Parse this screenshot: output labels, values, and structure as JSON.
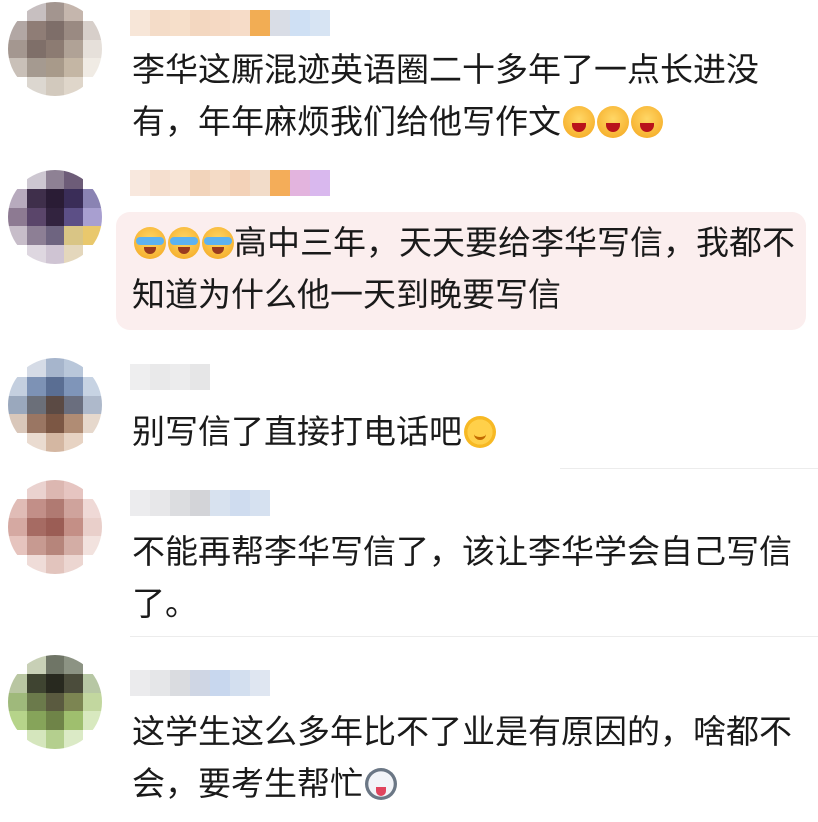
{
  "comments": [
    {
      "text": "李华这厮混迹英语圈二十多年了一点长进没有，年年麻烦我们给他写作文",
      "emojis": [
        "angry-face-icon",
        "angry-face-icon",
        "angry-face-icon"
      ],
      "avatar_colors": [
        "#ffffff",
        "#c7bfc0",
        "#a3958f",
        "#c5b6ad",
        "#ffffff",
        "#b2a7a4",
        "#8f7d76",
        "#7e6e69",
        "#9a8a82",
        "#d7cfca",
        "#a49790",
        "#7f6f69",
        "#8c7b72",
        "#b0a296",
        "#e6e0da",
        "#c9c0b8",
        "#a59a90",
        "#a89a8a",
        "#c4b6a4",
        "#f0ebe4",
        "#ffffff",
        "#dcd7d0",
        "#d2c9bd",
        "#dfd6ca",
        "#ffffff"
      ],
      "name_colors": [
        "#f7e6d8",
        "#f4dcc8",
        "#f6dfca",
        "#f3d7c0",
        "#f5d9c3",
        "#f6dcc8",
        "#f2ad54",
        "#d9dde6",
        "#cfe0f4",
        "#d7e4f3"
      ]
    },
    {
      "text": "高中三年，天天要给李华写信，我都不知道为什么他一天到晚要写信",
      "emojis": [
        "crying-laughing-icon",
        "crying-laughing-icon",
        "crying-laughing-icon"
      ],
      "avatar_colors": [
        "#ffffff",
        "#cdc7d1",
        "#8e8194",
        "#6d5c78",
        "#ffffff",
        "#b7aabd",
        "#3f2f4b",
        "#2a1c35",
        "#3a2d58",
        "#8a83b3",
        "#8d7a92",
        "#5a456a",
        "#32233f",
        "#5c4f86",
        "#a89fd0",
        "#c7bdc9",
        "#8d7f95",
        "#6e6480",
        "#d9c585",
        "#e9c86c",
        "#ffffff",
        "#ded7e0",
        "#cfc4d3",
        "#e4d7bc",
        "#ffffff"
      ],
      "name_colors": [
        "#f8e8de",
        "#f5dfcf",
        "#f7e4d6",
        "#f2d4bb",
        "#f4dbc6",
        "#f3d2b8",
        "#f2dcc9",
        "#f4ad59",
        "#e3b4de",
        "#d9b8ee"
      ]
    },
    {
      "text": "别写信了直接打电话吧",
      "emojis": [
        "sunflower-face-icon"
      ],
      "avatar_colors": [
        "#ffffff",
        "#d5dbe6",
        "#a6b5cc",
        "#b9c7da",
        "#ffffff",
        "#c4cfdf",
        "#7d92b5",
        "#5a6e93",
        "#7f95b9",
        "#c7d3e3",
        "#9aa8bd",
        "#6b6f79",
        "#5b4a44",
        "#6a6e7e",
        "#aeb9cb",
        "#d9c7ba",
        "#9a7663",
        "#7c5744",
        "#b08c74",
        "#e6d8cc",
        "#ffffff",
        "#eadbd0",
        "#d4b7a2",
        "#e7d3c3",
        "#ffffff"
      ],
      "name_colors": [
        "#eeeeef",
        "#e9e9ea",
        "#ececed",
        "#e6e6e7"
      ]
    },
    {
      "text": "不能再帮李华写信了，该让李华学会自己写信了。",
      "emojis": [],
      "avatar_colors": [
        "#ffffff",
        "#ead2cf",
        "#dcb7b1",
        "#e6c5c1",
        "#ffffff",
        "#e0bcb6",
        "#c28f88",
        "#b07a72",
        "#cfa39c",
        "#efd9d6",
        "#d5a9a2",
        "#a66b63",
        "#9b5d55",
        "#c48f86",
        "#e9cfca",
        "#e6c4be",
        "#c79a91",
        "#b6857b",
        "#d3ada5",
        "#f2e2de",
        "#ffffff",
        "#efdcd8",
        "#e2c4bd",
        "#ecd6d1",
        "#ffffff"
      ],
      "name_colors": [
        "#ececee",
        "#e7e7e9",
        "#dcdde0",
        "#d3d4d8",
        "#d8e2ef",
        "#cfdcef",
        "#d6e1f0"
      ]
    },
    {
      "text": "这学生这么多年比不了业是有原因的，啥都不会，要考生帮忙",
      "emojis": [
        "husky-face-icon"
      ],
      "avatar_colors": [
        "#ffffff",
        "#c8d0b6",
        "#6f7566",
        "#8c9383",
        "#ffffff",
        "#b9c6a2",
        "#3f4431",
        "#28291f",
        "#4b4c3b",
        "#b7c7a4",
        "#9fb97b",
        "#6b7a4b",
        "#5a5a3f",
        "#7c8552",
        "#c2d79f",
        "#b6d48a",
        "#86a45a",
        "#6f8448",
        "#9fbf6e",
        "#d8e9bf",
        "#ffffff",
        "#d5e6bd",
        "#b4cf8e",
        "#dbeac6",
        "#ffffff"
      ],
      "name_colors": [
        "#ebebed",
        "#e5e6e8",
        "#dadce0",
        "#cfd6e4",
        "#c8d7ee",
        "#d3dfef",
        "#dfe6f1"
      ]
    }
  ]
}
